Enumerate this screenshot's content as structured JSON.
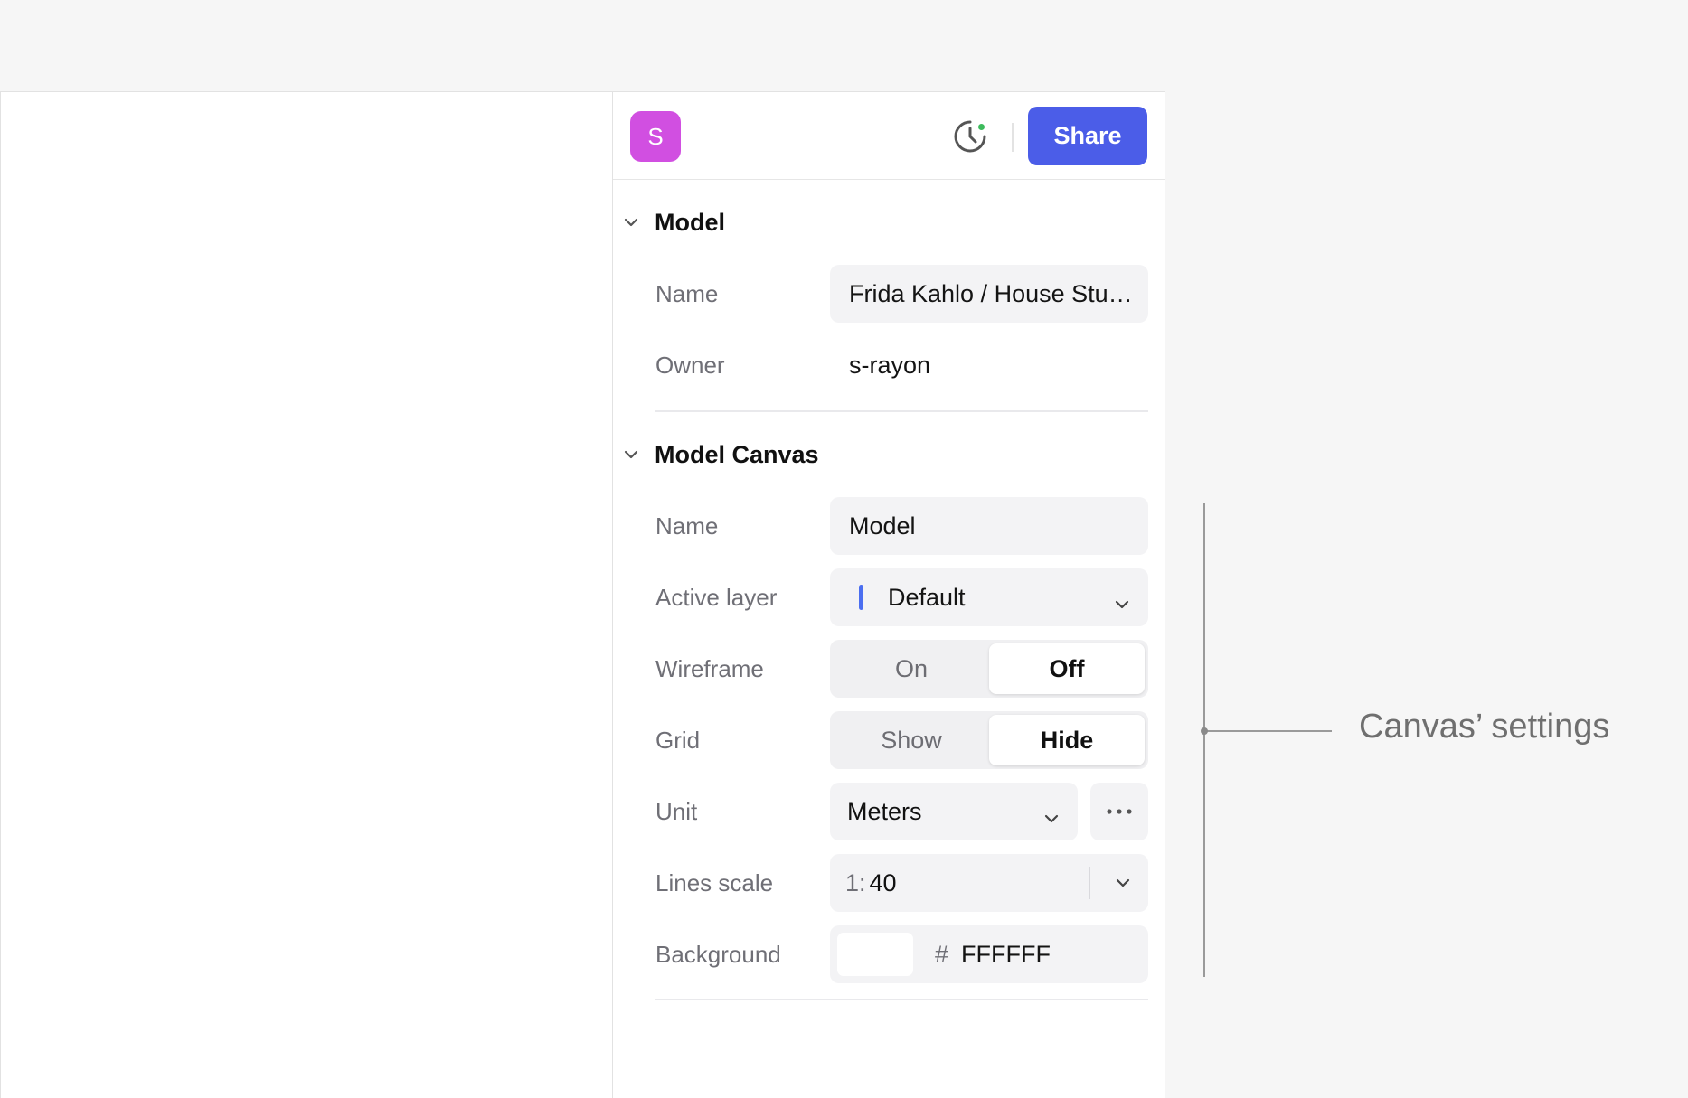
{
  "header": {
    "avatar_initial": "S",
    "avatar_color": "#d14fe1",
    "history_icon": "clock-history-icon",
    "status_dot_color": "#3dbb5c",
    "share_label": "Share",
    "share_color": "#4b5de8"
  },
  "model": {
    "title": "Model",
    "name_label": "Name",
    "name_value": "Frida Kahlo / House Stu…",
    "owner_label": "Owner",
    "owner_value": "s-rayon"
  },
  "canvas": {
    "title": "Model Canvas",
    "name_label": "Name",
    "name_value": "Model",
    "active_layer_label": "Active layer",
    "active_layer_value": "Default",
    "layer_color": "#4b6ef0",
    "wireframe_label": "Wireframe",
    "wireframe_on": "On",
    "wireframe_off": "Off",
    "wireframe_selected": "Off",
    "grid_label": "Grid",
    "grid_show": "Show",
    "grid_hide": "Hide",
    "grid_selected": "Hide",
    "unit_label": "Unit",
    "unit_value": "Meters",
    "lines_scale_label": "Lines scale",
    "lines_scale_prefix": "1:",
    "lines_scale_value": "40",
    "background_label": "Background",
    "background_hash": "#",
    "background_hex": "FFFFFF",
    "background_swatch": "#ffffff"
  },
  "annotation": {
    "text": "Canvas’ settings"
  }
}
